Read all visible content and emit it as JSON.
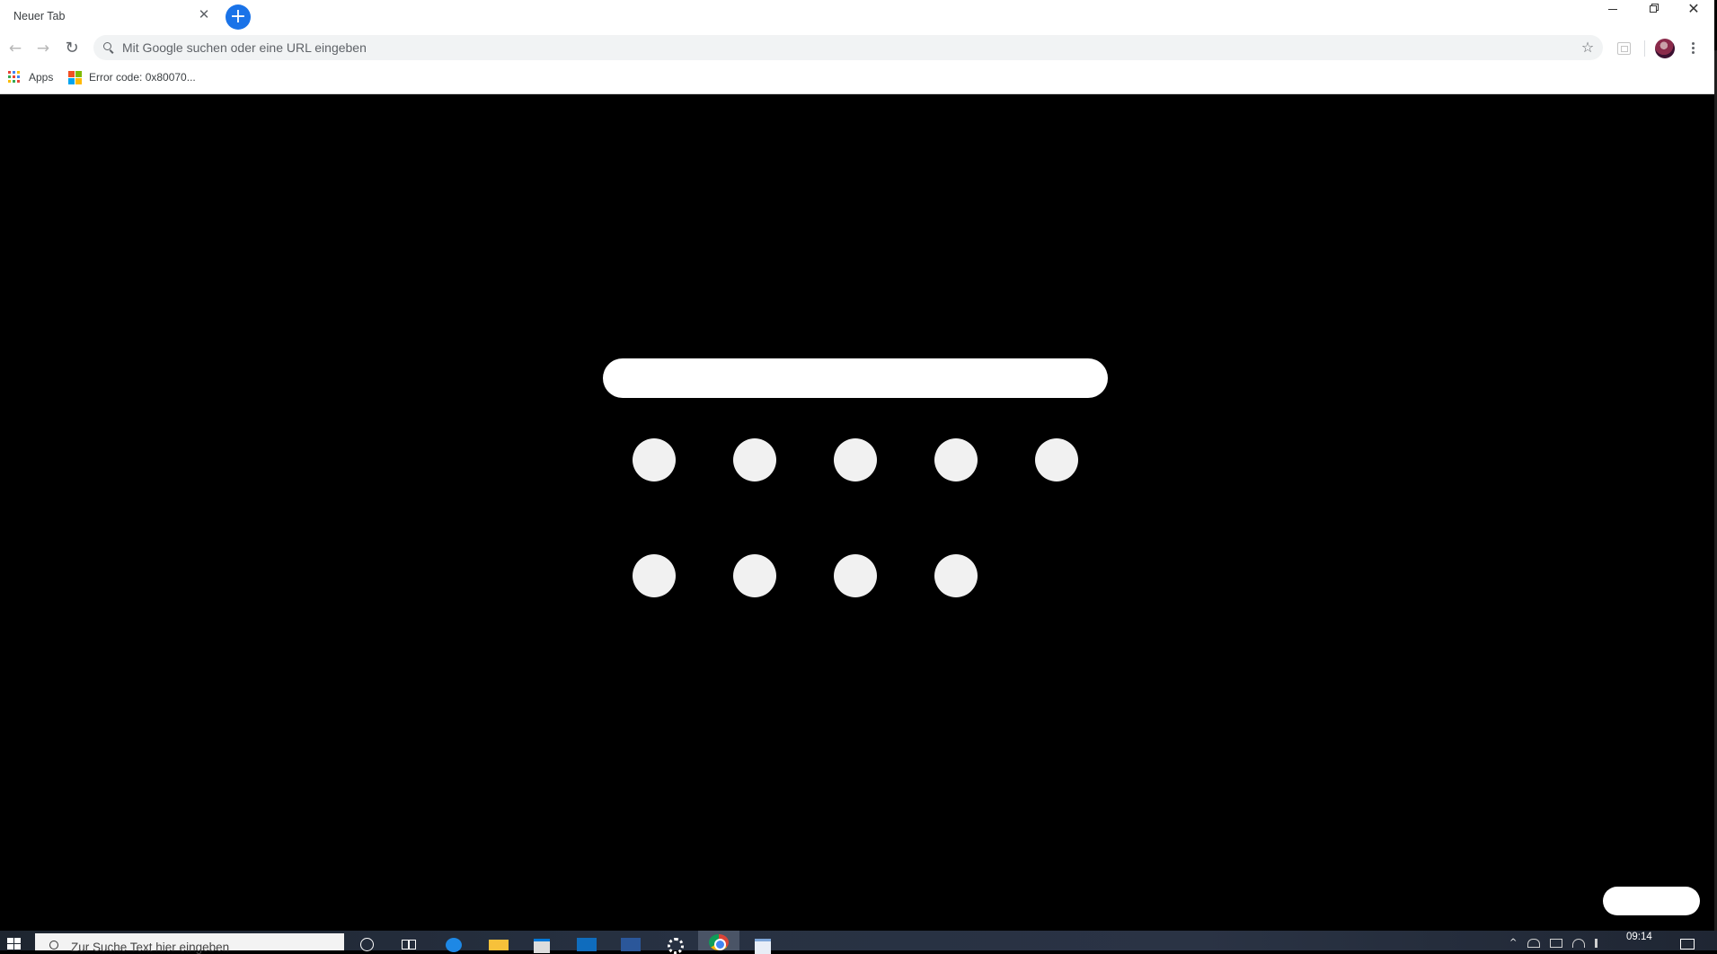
{
  "browser": {
    "tab": {
      "title": "Neuer Tab",
      "close_glyph": "✕",
      "icon_close": "close-icon"
    },
    "new_tab_glyph": "+",
    "window_controls": {
      "minimize": "minimize-icon",
      "restore": "restore-icon",
      "close": "✕"
    },
    "toolbar": {
      "back_glyph": "←",
      "forward_glyph": "→",
      "reload_glyph": "↻",
      "omnibox_placeholder": "Mit Google suchen oder eine URL eingeben",
      "omnibox_value": "",
      "bookmark_star_glyph": "☆",
      "accent_color": "#1a73e8"
    },
    "bookmarks": [
      {
        "label": "Apps",
        "icon": "apps-grid-icon"
      },
      {
        "label": "Error code: 0x80070...",
        "icon": "microsoft-logo-icon"
      }
    ]
  },
  "ntp": {
    "background_color": "#000000",
    "search_box_color": "#ffffff",
    "tile_color": "#f1f1f1",
    "shortcut_rows": [
      5,
      4
    ]
  },
  "taskbar": {
    "search_placeholder": "Zur Suche Text hier eingeben",
    "pinned_apps": [
      "cortana-icon",
      "task-view-icon",
      "edge-icon",
      "file-explorer-icon",
      "store-icon",
      "outlook-icon",
      "word-icon",
      "settings-icon",
      "chrome-icon",
      "notepad-icon"
    ],
    "clock": "09:14",
    "tray_chevron": "^"
  }
}
